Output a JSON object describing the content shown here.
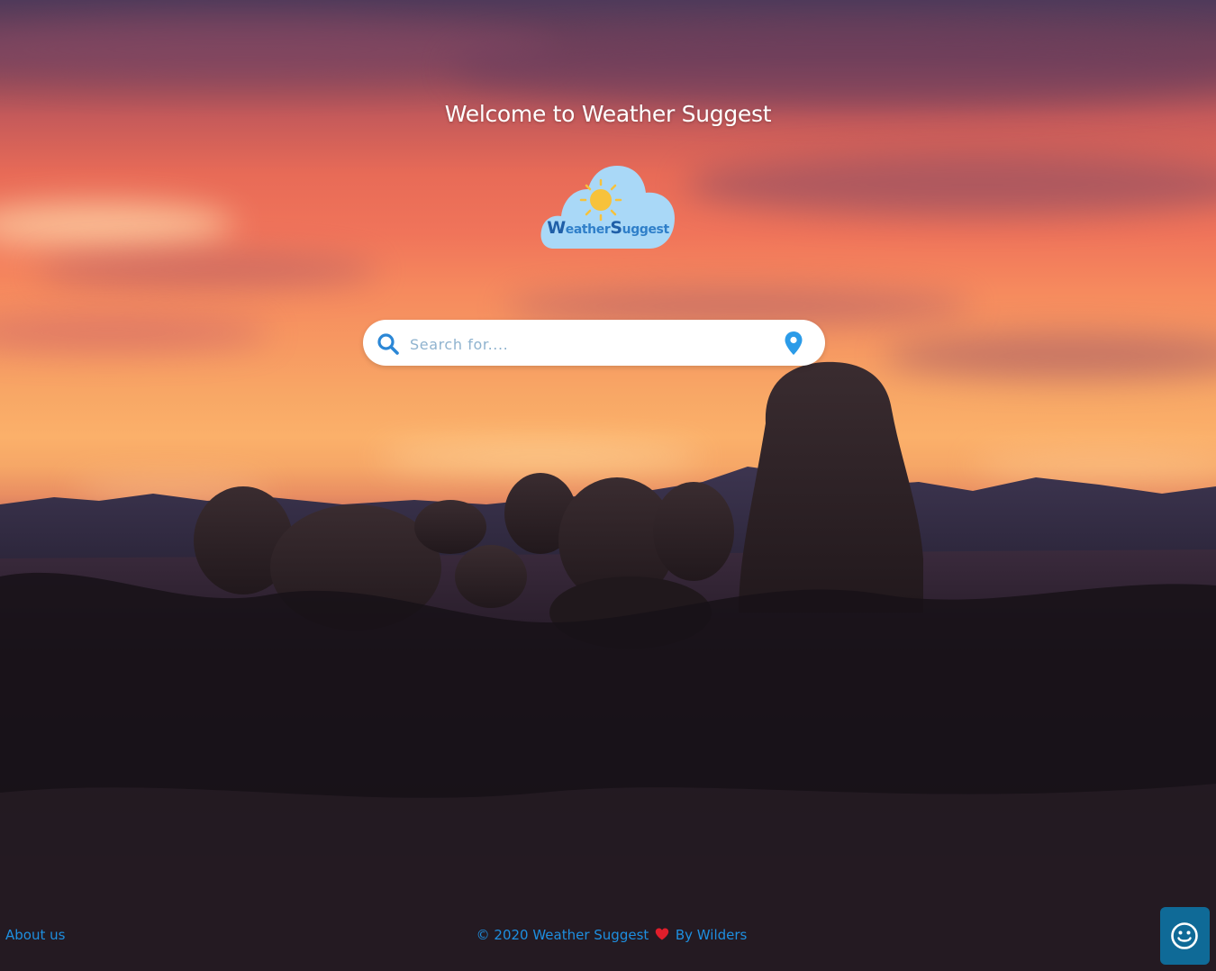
{
  "header": {
    "title": "Welcome to Weather Suggest"
  },
  "logo": {
    "text_w": "W",
    "text_eather": "eather",
    "text_s": "S",
    "text_uggest": "uggest",
    "icon": "cloud-sun-icon"
  },
  "search": {
    "placeholder": "Search for....",
    "value": "",
    "search_icon": "search-icon",
    "location_icon": "map-pin-icon"
  },
  "footer": {
    "about_label": "About us",
    "copyright_prefix": "© 2020 Weather Suggest",
    "heart_icon": "heart-icon",
    "copyright_suffix": "By Wilders",
    "chat_icon": "smiley-icon"
  },
  "colors": {
    "accent": "#1e8fe0",
    "search_icon": "#2b87d6",
    "chat_button": "#0f6a97",
    "heart": "#e01e2b"
  }
}
